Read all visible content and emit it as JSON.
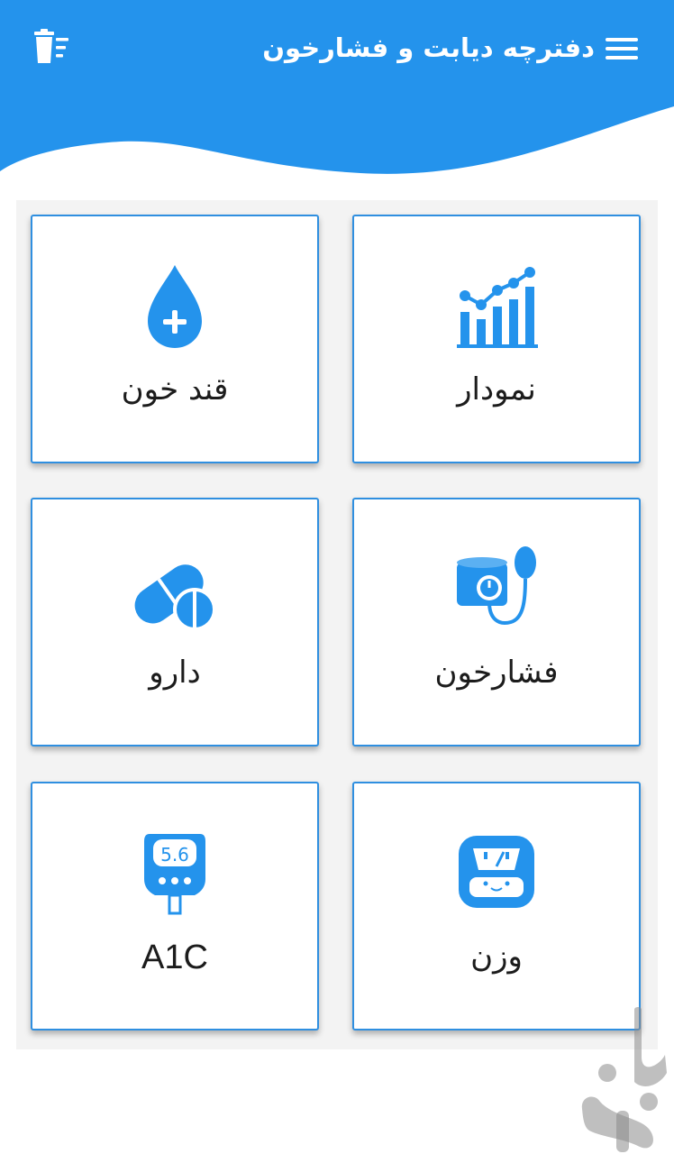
{
  "header": {
    "title": "دفترچه دیابت و فشارخون",
    "menu_icon": "hamburger-menu-icon",
    "trash_icon": "trash-list-icon",
    "color": "#2493ec"
  },
  "cards": {
    "blood_sugar": {
      "label": "قند خون",
      "icon": "blood-drop-plus-icon"
    },
    "chart": {
      "label": "نمودار",
      "icon": "bar-line-chart-icon"
    },
    "medicine": {
      "label": "دارو",
      "icon": "pills-icon"
    },
    "blood_pressure": {
      "label": "فشارخون",
      "icon": "blood-pressure-gauge-icon"
    },
    "a1c": {
      "label": "A1C",
      "icon": "glucometer-icon",
      "meter_value": "5.6"
    },
    "weight": {
      "label": "وزن",
      "icon": "weight-scale-icon"
    }
  },
  "colors": {
    "accent": "#2493ec",
    "card_border": "#2f8fe0",
    "text": "#1c1c1c"
  }
}
